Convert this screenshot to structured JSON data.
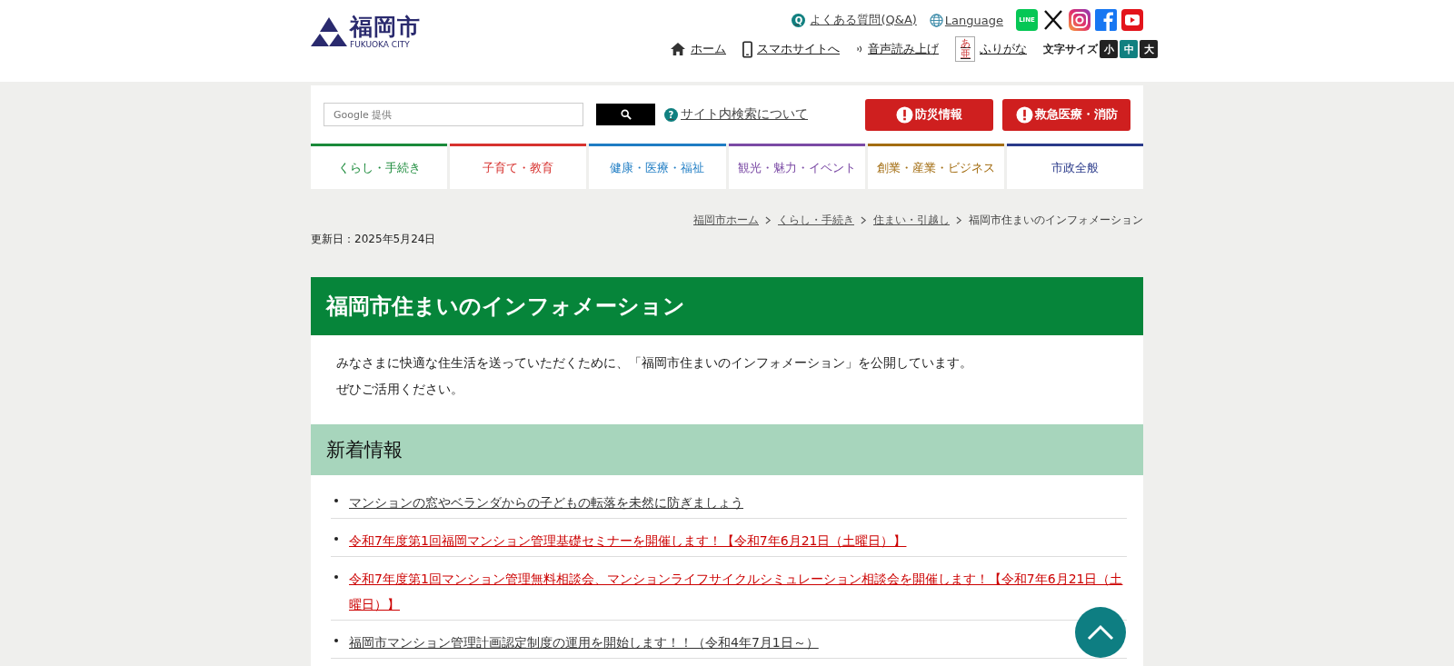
{
  "header": {
    "logo_name": "福岡市",
    "logo_sub": "FUKUOKA CITY",
    "top_links": [
      {
        "kind": "faq",
        "label": "よくある質問(Q&A)",
        "icon_text": "Q"
      },
      {
        "kind": "language",
        "label": "Language"
      }
    ],
    "social": [
      {
        "kind": "line",
        "label": "LINE"
      },
      {
        "kind": "x"
      },
      {
        "kind": "instagram"
      },
      {
        "kind": "facebook"
      },
      {
        "kind": "youtube"
      }
    ],
    "utility_links": [
      {
        "kind": "home",
        "label": "ホーム"
      },
      {
        "kind": "phone",
        "label": "スマホサイトへ"
      },
      {
        "kind": "voice",
        "label": "音声読み上げ"
      },
      {
        "kind": "furigana",
        "label": "ふりがな",
        "icon_text": "あ亜"
      }
    ],
    "font_size": {
      "label": "文字サイズ",
      "options": [
        {
          "label": "小",
          "selected": false
        },
        {
          "label": "中",
          "selected": true
        },
        {
          "label": "大",
          "selected": false
        }
      ]
    }
  },
  "search": {
    "placeholder": "Google 提供",
    "help_link": "サイト内検索について",
    "icon_text": "?"
  },
  "alert_buttons": [
    {
      "label": "防災情報"
    },
    {
      "label": "救急医療・消防"
    }
  ],
  "nav_tabs": [
    {
      "label": "くらし・手続き",
      "color": "#1a8a3a"
    },
    {
      "label": "子育て・教育",
      "color": "#d7322f"
    },
    {
      "label": "健康・医療・福祉",
      "color": "#1f7dc4"
    },
    {
      "label": "観光・魅力・イベント",
      "color": "#7b4aa5"
    },
    {
      "label": "創業・産業・ビジネス",
      "color": "#a36d12"
    },
    {
      "label": "市政全般",
      "color": "#2a3a8a"
    }
  ],
  "breadcrumb": {
    "links": [
      "福岡市ホーム",
      "くらし・手続き",
      "住まい・引越し"
    ],
    "current": "福岡市住まいのインフォメーション"
  },
  "updated": "更新日：2025年5月24日",
  "page_title": "福岡市住まいのインフォメーション",
  "intro": [
    "みなさまに快適な住生活を送っていただくために、「福岡市住まいのインフォメーション」を公開しています。",
    "ぜひご活用ください。"
  ],
  "news": {
    "heading": "新着情報",
    "items": [
      {
        "text": "マンションの窓やベランダからの子どもの転落を未然に防ぎましょう",
        "color": "#333333"
      },
      {
        "text": "令和7年度第1回福岡マンション管理基礎セミナーを開催します！【令和7年6月21日（土曜日）】",
        "color": "#cc0000"
      },
      {
        "text": "令和7年度第1回マンション管理無料相談会、マンションライフサイクルシミュレーション相談会を開催します！【令和7年6月21日（土曜日）】",
        "color": "#cc0000"
      },
      {
        "text": "福岡市マンション管理計画認定制度の運用を開始します！！（令和4年7月1日～）",
        "color": "#333333"
      }
    ]
  }
}
